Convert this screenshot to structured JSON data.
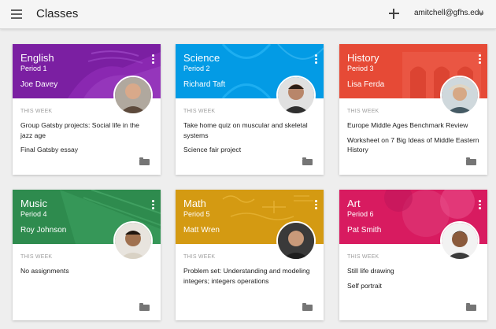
{
  "app": {
    "title": "Classes",
    "account": "amitchell@gfhs.edu"
  },
  "section_label": "THIS WEEK",
  "classes": [
    {
      "subject": "English",
      "period": "Period 1",
      "teacher": "Joe Davey",
      "color": "#7b1fa2",
      "items": [
        "Group Gatsby projects: Social life in the jazz age",
        "Final Gatsby essay"
      ]
    },
    {
      "subject": "Science",
      "period": "Period 2",
      "teacher": "Richard Taft",
      "color": "#039be5",
      "items": [
        "Take home quiz on muscular and skeletal systems",
        "Science fair project"
      ]
    },
    {
      "subject": "History",
      "period": "Period 3",
      "teacher": "Lisa Ferda",
      "color": "#e64a36",
      "items": [
        "Europe Middle Ages Benchmark Review",
        "Worksheet on 7 Big Ideas of Middle Eastern History"
      ]
    },
    {
      "subject": "Music",
      "period": "Period 4",
      "teacher": "Roy Johnson",
      "color": "#2e8b4e",
      "items": [
        "No assignments"
      ]
    },
    {
      "subject": "Math",
      "period": "Period 5",
      "teacher": "Matt Wren",
      "color": "#d49a12",
      "items": [
        "Problem set: Understanding and modeling integers; integers operations"
      ]
    },
    {
      "subject": "Art",
      "period": "Period 6",
      "teacher": "Pat Smith",
      "color": "#d81b60",
      "items": [
        "Still life drawing",
        "Self portrait"
      ]
    }
  ]
}
